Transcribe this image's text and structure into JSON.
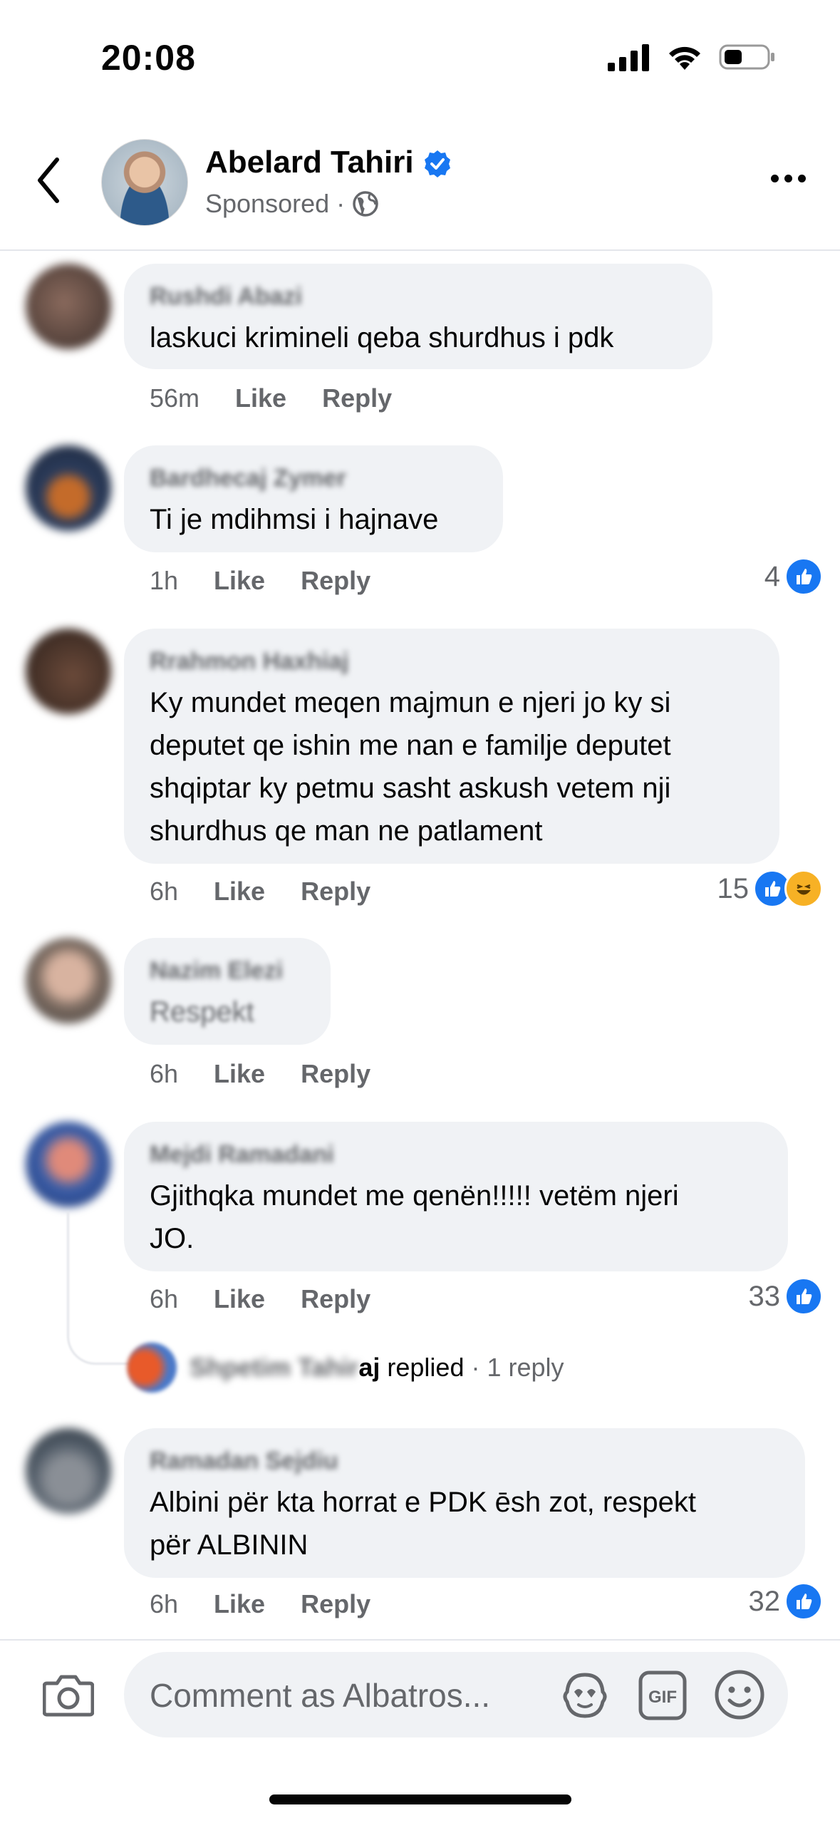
{
  "status_bar": {
    "time": "20:08"
  },
  "header": {
    "page_name": "Abelard Tahiri",
    "sponsored": "Sponsored ·"
  },
  "comments": [
    {
      "author": "Rushdi Abazi",
      "text": "laskuci krimineli qeba shurdhus i pdk",
      "time": "56m",
      "like": "Like",
      "reply": "Reply"
    },
    {
      "author": "Bardhecaj Zymer",
      "text": "Ti je mdihmsi i hajnave",
      "time": "1h",
      "like": "Like",
      "reply": "Reply",
      "reactions": "4"
    },
    {
      "author": "Rrahmon Haxhiaj",
      "lines": [
        "Ky mundet meqen majmun e njeri jo ky si",
        "deputet qe ishin me nan e familje deputet",
        "shqiptar ky petmu sasht askush vetem nji",
        "shurdhus qe man ne patlament"
      ],
      "time": "6h",
      "like": "Like",
      "reply": "Reply",
      "reactions": "15"
    },
    {
      "author": "Nazim Elezi",
      "text": "Respekt",
      "time": "6h",
      "like": "Like",
      "reply": "Reply"
    },
    {
      "author": "Mejdi Ramadani",
      "lines": [
        "Gjithqka mundet me qenën!!!!! vetëm njeri",
        "JO."
      ],
      "time": "6h",
      "like": "Like",
      "reply": "Reply",
      "reactions": "33",
      "reply_preview": {
        "author_blurred": "Shpetim Tahir",
        "author_end": "aj",
        "replied": "replied",
        "count": "· 1 reply"
      }
    },
    {
      "author": "Ramadan Sejdiu",
      "lines": [
        "Albini për kta horrat e PDK ēsh zot, respekt",
        "për ALBININ"
      ],
      "time": "6h",
      "like": "Like",
      "reply": "Reply",
      "reactions": "32"
    }
  ],
  "composer": {
    "placeholder": "Comment as Albatros..."
  }
}
